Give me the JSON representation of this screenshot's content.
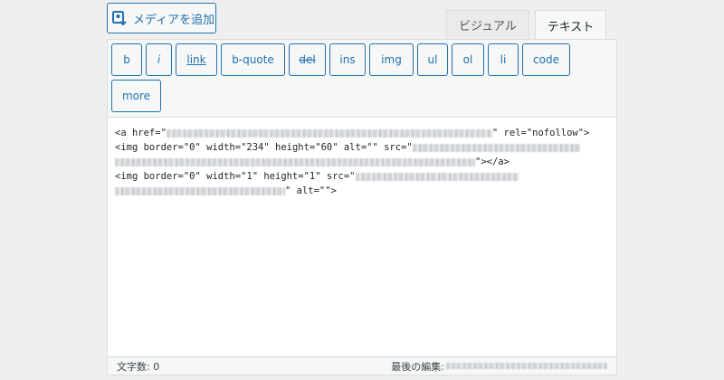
{
  "media": {
    "label": "メディアを追加",
    "icon": "media-add-icon"
  },
  "tabs": [
    {
      "label": "ビジュアル",
      "active": false
    },
    {
      "label": "テキスト",
      "active": true
    }
  ],
  "quicktags": [
    "b",
    "i",
    "link",
    "b-quote",
    "del",
    "ins",
    "img",
    "ul",
    "ol",
    "li",
    "code",
    "more"
  ],
  "editor": {
    "line1_start": "<a href=\"",
    "line1_end": "\" rel=\"nofollow\">",
    "line2_start": "<img border=\"0\" width=\"234\" height=\"60\" alt=\"\" src=\"",
    "line3_end": "\"></a>",
    "line4_start": "<img border=\"0\" width=\"1\" height=\"1\" src=\"",
    "line5_end": "\" alt=\"\">"
  },
  "status": {
    "word_count": "文字数: 0",
    "last_edit": "最後の編集:"
  },
  "colors": {
    "accent": "#2271b1",
    "border": "#dcdcde",
    "background": "#efefef"
  }
}
